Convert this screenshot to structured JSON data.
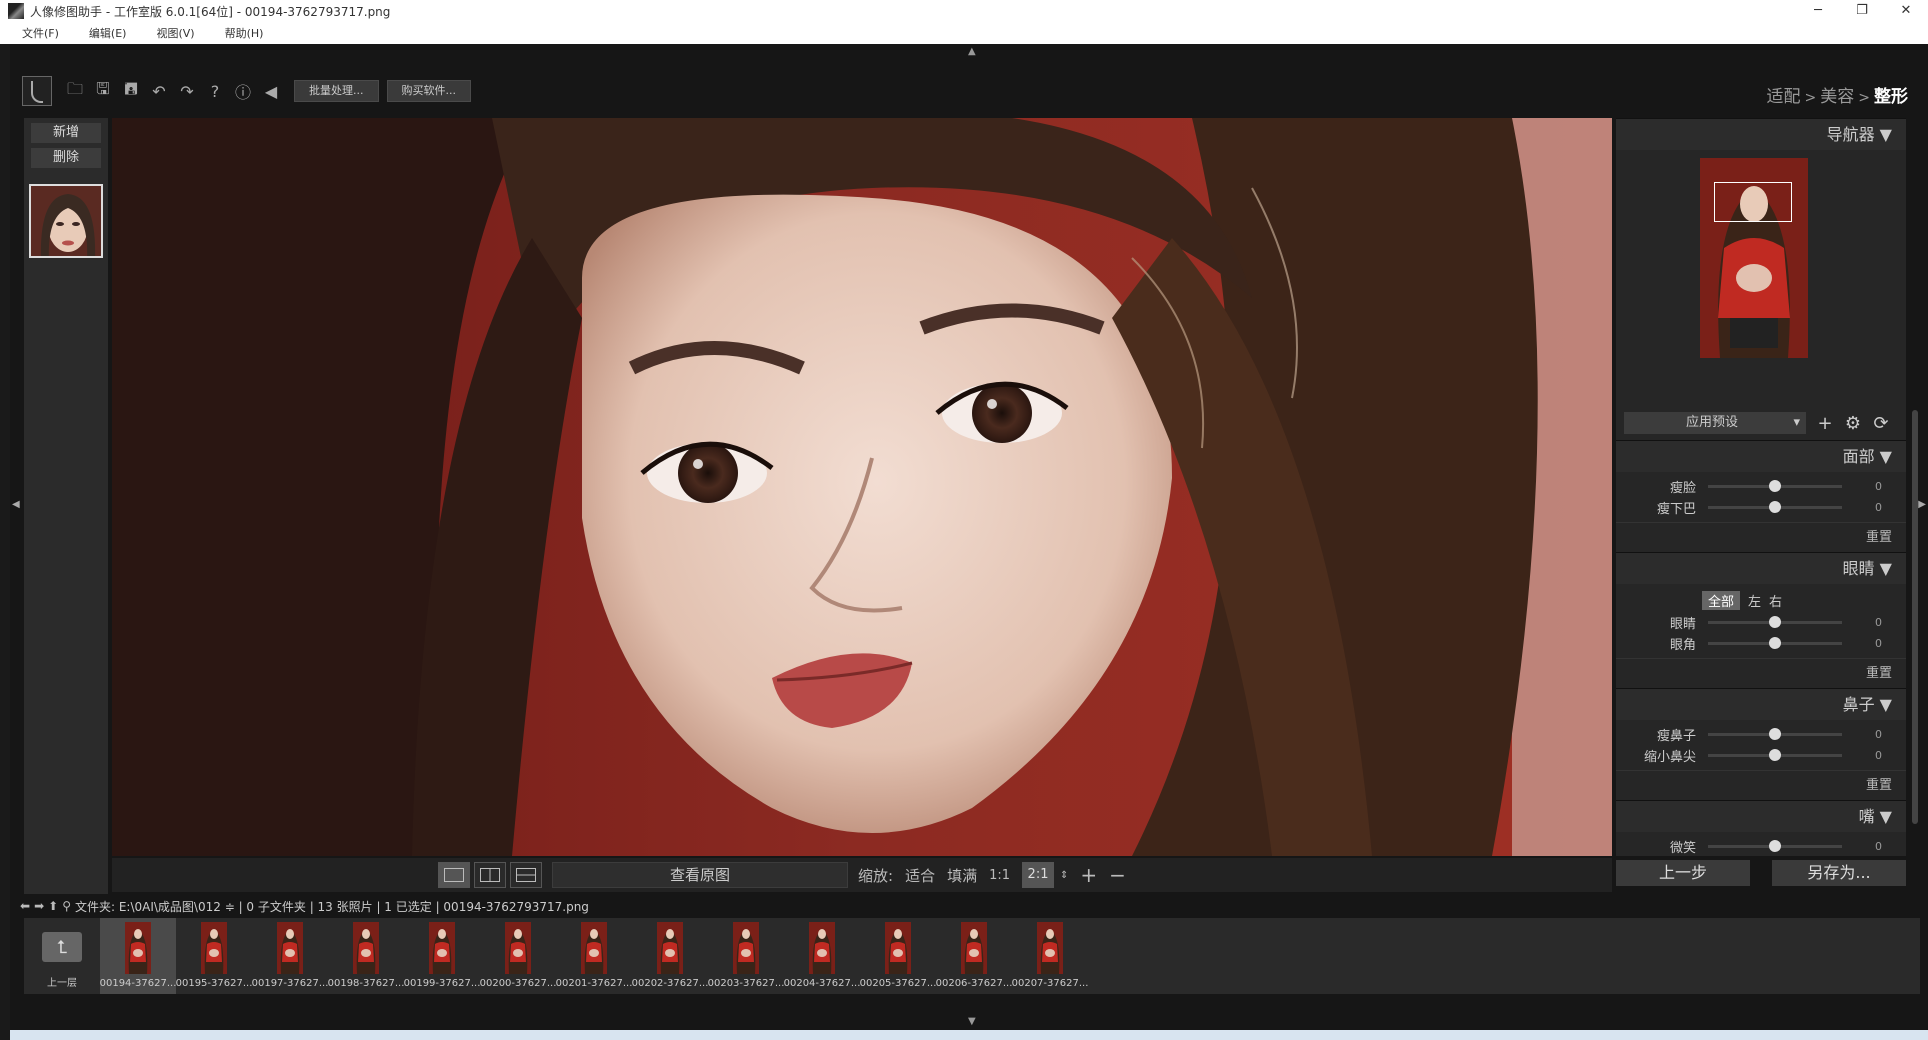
{
  "window": {
    "title": "人像修图助手 - 工作室版 6.0.1[64位] - 00194-3762793717.png",
    "min": "─",
    "max": "❐",
    "close": "✕"
  },
  "menu": [
    "文件(F)",
    "编辑(E)",
    "视图(V)",
    "帮助(H)"
  ],
  "toolbar": {
    "batch_label": "批量处理...",
    "buy_label": "购买软件..."
  },
  "breadcrumb": {
    "step1": "适配",
    "step2": "美容",
    "step3": "整形",
    "sep": ">"
  },
  "left": {
    "add_label": "新增",
    "delete_label": "删除"
  },
  "navigator": {
    "title": "导航器 ▼"
  },
  "preset": {
    "label": "应用预设"
  },
  "face": {
    "title": "面部 ▼",
    "sliders": [
      {
        "label": "瘦脸",
        "value": "0"
      },
      {
        "label": "瘦下巴",
        "value": "0"
      }
    ],
    "reset": "重置"
  },
  "eyes": {
    "title": "眼睛 ▼",
    "tabs": [
      "全部",
      "左",
      "右"
    ],
    "sliders": [
      {
        "label": "眼睛",
        "value": "0"
      },
      {
        "label": "眼角",
        "value": "0"
      }
    ],
    "reset": "重置"
  },
  "nose": {
    "title": "鼻子 ▼",
    "sliders": [
      {
        "label": "瘦鼻子",
        "value": "0"
      },
      {
        "label": "缩小鼻尖",
        "value": "0"
      }
    ],
    "reset": "重置"
  },
  "mouth": {
    "title": "嘴 ▼",
    "sliders": [
      {
        "label": "微笑",
        "value": "0"
      }
    ]
  },
  "viewbar": {
    "original_label": "查看原图",
    "zoom_label": "缩放:",
    "fit": "适合",
    "fill": "填满",
    "one": "1:1",
    "zoom_value": "2:1",
    "plus": "+",
    "minus": "−"
  },
  "actions": {
    "undo": "上一步",
    "saveas": "另存为..."
  },
  "pathbar": {
    "text": "文件夹: E:\\0AI\\成品图\\012 ≑ | 0 子文件夹 | 13 张照片 | 1 已选定 | 00194-3762793717.png"
  },
  "filmstrip": {
    "up_label": "上一层",
    "items": [
      "00194-37627...",
      "00195-37627...",
      "00197-37627...",
      "00198-37627...",
      "00199-37627...",
      "00200-37627...",
      "00201-37627...",
      "00202-37627...",
      "00203-37627...",
      "00204-37627...",
      "00205-37627...",
      "00206-37627...",
      "00207-37627..."
    ]
  }
}
